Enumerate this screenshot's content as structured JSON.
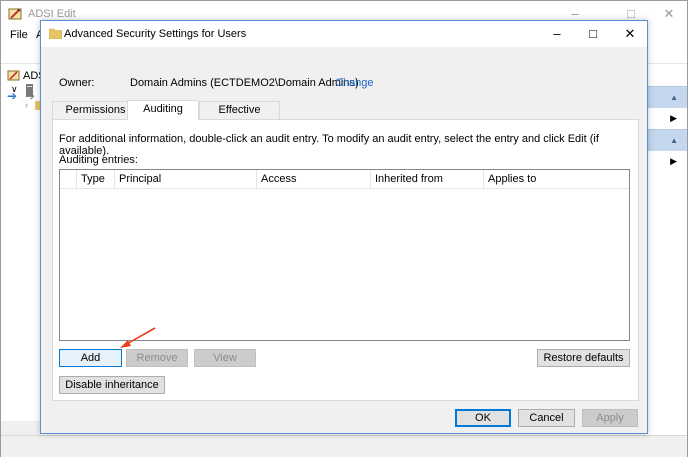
{
  "background_window": {
    "title": "ADSI Edit",
    "menu": [
      "File",
      "A"
    ],
    "tree_label": "ADS",
    "controls": [
      "minimize",
      "maximize",
      "close"
    ]
  },
  "dialog": {
    "title": "Advanced Security Settings for Users",
    "owner": {
      "label": "Owner:",
      "value": "Domain Admins (ECTDEMO2\\Domain Admins)",
      "change_link": "Change"
    },
    "tabs": [
      {
        "label": "Permissions",
        "active": false
      },
      {
        "label": "Auditing",
        "active": true
      },
      {
        "label": "Effective Access",
        "active": false
      }
    ],
    "info_text": "For additional information, double-click an audit entry. To modify an audit entry, select the entry and click Edit (if available).",
    "entries_label": "Auditing entries:",
    "columns": [
      "Type",
      "Principal",
      "Access",
      "Inherited from",
      "Applies to"
    ],
    "rows": [],
    "buttons": {
      "add": "Add",
      "remove": "Remove",
      "view": "View",
      "restore_defaults": "Restore defaults",
      "disable_inheritance": "Disable inheritance",
      "ok": "OK",
      "cancel": "Cancel",
      "apply": "Apply"
    }
  },
  "colors": {
    "link": "#1a64c8",
    "annotation_arrow": "#e8401c",
    "focus_border": "#0078d7",
    "action_pane_header": "#c4d7ee"
  }
}
